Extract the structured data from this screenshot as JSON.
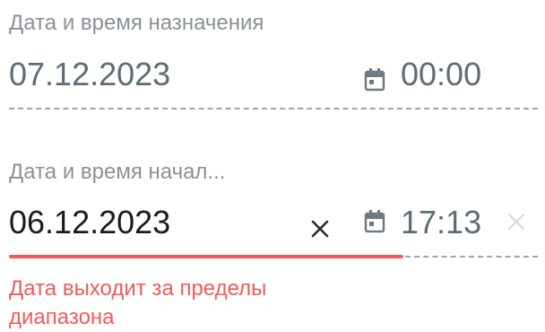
{
  "appointment": {
    "label": "Дата и время назначения",
    "date": "07.12.2023",
    "time": "00:00",
    "calendar_icon": "calendar-icon"
  },
  "start": {
    "label": "Дата и время начал...",
    "date": "06.12.2023",
    "time": "17:13",
    "clear_icon": "close-icon",
    "calendar_icon": "calendar-icon",
    "time_clear_icon": "close-icon",
    "error": {
      "line1": "Дата выходит за пределы",
      "line2": "диапазона"
    }
  },
  "colors": {
    "label": "#8a9196",
    "muted_value": "#5f6c75",
    "dark_value": "#1b1b1b",
    "error": "#f15a5a",
    "dashed": "#9ea4a8",
    "icon": "#6f7a82",
    "icon_disabled": "#d5d9dc"
  }
}
